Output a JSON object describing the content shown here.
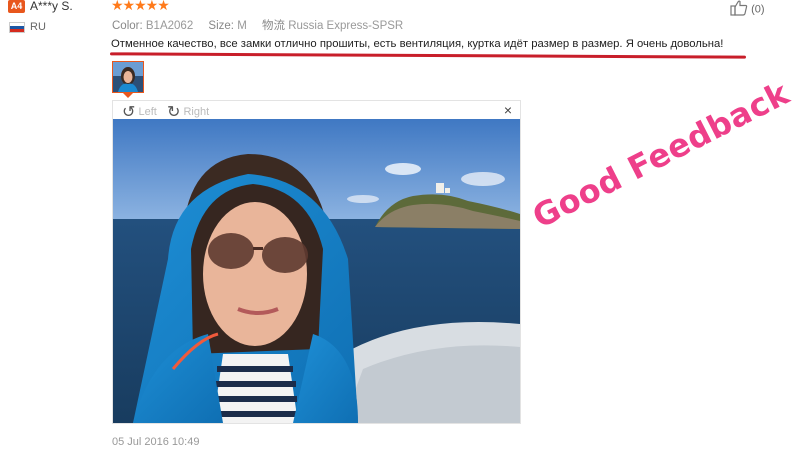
{
  "reviewer": {
    "badge": "A4",
    "name": "A***y S.",
    "country": "RU"
  },
  "review": {
    "stars": "★★★★★",
    "color_label": "Color:",
    "color_value": "B1A2062",
    "size_label": "Size:",
    "size_value": "M",
    "shipping_label": "物流",
    "shipping_value": "Russia Express-SPSR",
    "text": "Отменное качество, все замки отлично прошиты, есть вентиляция, куртка идёт размер в размер. Я очень довольна!",
    "date": "05 Jul 2016 10:49"
  },
  "helpful": {
    "count": "(0)"
  },
  "viewer": {
    "rotate_left": "Left",
    "rotate_right": "Right",
    "close": "×"
  },
  "overlay": {
    "stamp": "Good Feedback"
  },
  "colors": {
    "accent": "#e8571d",
    "star": "#ff7a1a",
    "underline": "#c81e2a",
    "stamp": "#ee3f8a"
  }
}
